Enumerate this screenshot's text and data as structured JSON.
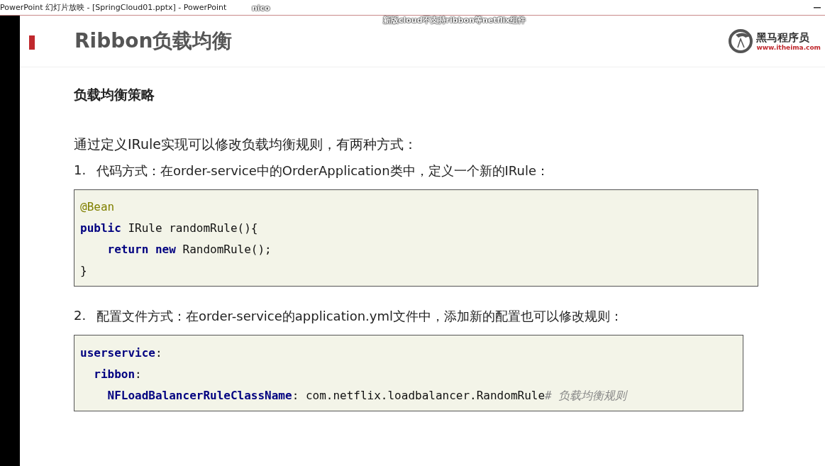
{
  "window": {
    "title": "PowerPoint 幻灯片放映 - [SpringCloud01.pptx] - PowerPoint"
  },
  "overlay_texts": [
    {
      "text": "nico"
    },
    {
      "text": "新版cloud不支持ribbon等netflix组件"
    }
  ],
  "slide": {
    "title": "Ribbon负载均衡",
    "logo": {
      "name": "黑马程序员",
      "url": "www.itheima.com"
    },
    "heading": "负载均衡策略",
    "intro": "通过定义IRule实现可以修改负载均衡规则，有两种方式：",
    "items": [
      {
        "number": "1.",
        "text": "代码方式：在order-service中的OrderApplication类中，定义一个新的IRule：",
        "code": [
          [
            {
              "kind": "annotation",
              "text": "@Bean"
            }
          ],
          [
            {
              "kind": "keyword",
              "text": "public"
            },
            {
              "kind": "plain",
              "text": " IRule randomRule(){"
            }
          ],
          [
            {
              "kind": "keyword",
              "text": "    return new"
            },
            {
              "kind": "plain",
              "text": " RandomRule();"
            }
          ],
          [
            {
              "kind": "plain",
              "text": "}"
            }
          ]
        ]
      },
      {
        "number": "2.",
        "text": "配置文件方式：在order-service的application.yml文件中，添加新的配置也可以修改规则：",
        "code": [
          [
            {
              "kind": "keyword",
              "text": "userservice"
            },
            {
              "kind": "plain",
              "text": ":"
            }
          ],
          [
            {
              "kind": "keyword",
              "text": "  ribbon"
            },
            {
              "kind": "plain",
              "text": ":"
            }
          ],
          [
            {
              "kind": "keyword",
              "text": "    NFLoadBalancerRuleClassName"
            },
            {
              "kind": "plain",
              "text": ": com.netflix.loadbalancer.RandomRule"
            },
            {
              "kind": "comment",
              "text": "# 负载均衡规则"
            }
          ]
        ]
      }
    ]
  }
}
